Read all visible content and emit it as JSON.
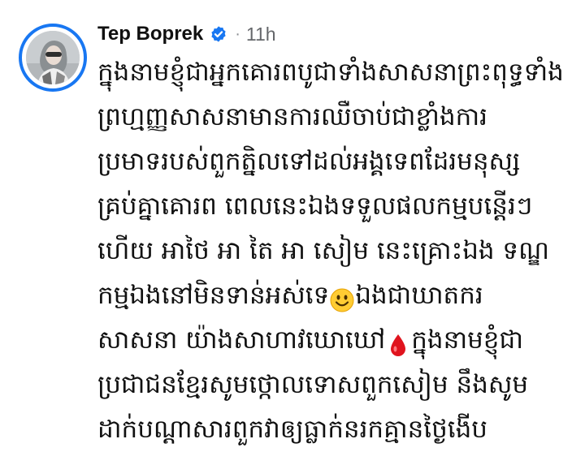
{
  "post": {
    "author": {
      "name": "Tep Boprek",
      "verified_icon": "verified-badge-icon",
      "avatar_icon": "profile-avatar"
    },
    "meta": {
      "separator": "·",
      "timestamp": "11h"
    },
    "body_lines": [
      {
        "text": "ក្នុងនាមខ្ញុំជាអ្នកគោរពបូជាទាំងសាសនាព្រះពុទ្ធទាំង"
      },
      {
        "text": "ព្រហ្មញ្ញសាសនាមានការឈឺចាប់ជាខ្លាំងការ"
      },
      {
        "text": "ប្រមាទរបស់ពួកត្និលទៅដល់អង្គទេពដែរមនុស្ស"
      },
      {
        "text": "គ្រប់គ្នាគោរព ពេលនេះឯងទទួលផលកម្មបន្តើរៗ"
      },
      {
        "text": "ហើយ អាថៃ អា តៃ អា សៀម នេះគ្រោះឯង ទណ្ឌ"
      },
      {
        "text": "កម្មឯងនៅមិនទាន់អស់ទេ",
        "emoji": "smiling-face-emoji",
        "after": "ឯងជាឃាតករ"
      },
      {
        "text": "សាសនា យ៉ាងសាហាវឃោឃៅ",
        "emoji": "blood-drop-emoji",
        "after": "ក្នុងនាមខ្ញុំជា"
      },
      {
        "text": "ប្រជាជនខ្មែរសូមថ្កោលទោសពួកសៀម នឹងសូម"
      },
      {
        "text": "ដាក់បណ្តាសារពួកវាឲ្យធ្លាក់នរកគ្មានថ្ងៃងើប"
      }
    ],
    "colors": {
      "accent": "#1877f2",
      "text": "#101010",
      "muted": "#65676b"
    }
  }
}
